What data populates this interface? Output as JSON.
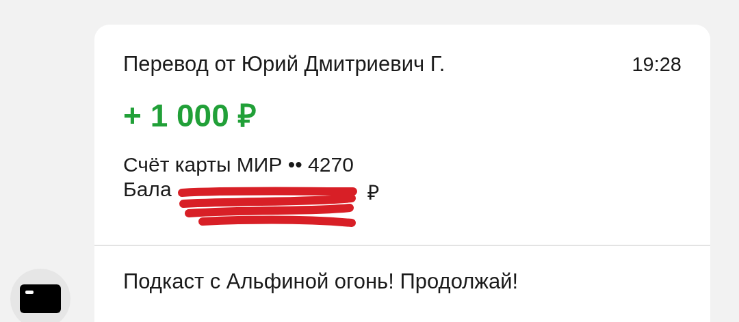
{
  "notification": {
    "title": "Перевод от Юрий Дмитриевич Г.",
    "time": "19:28",
    "amount": "+ 1 000 ₽",
    "account": "Счёт карты МИР •• 4270",
    "balance_start": "Бала",
    "balance_end": "₽",
    "redacted": true
  },
  "message": {
    "text": "Подкаст с Альфиной огонь! Продолжай!"
  }
}
